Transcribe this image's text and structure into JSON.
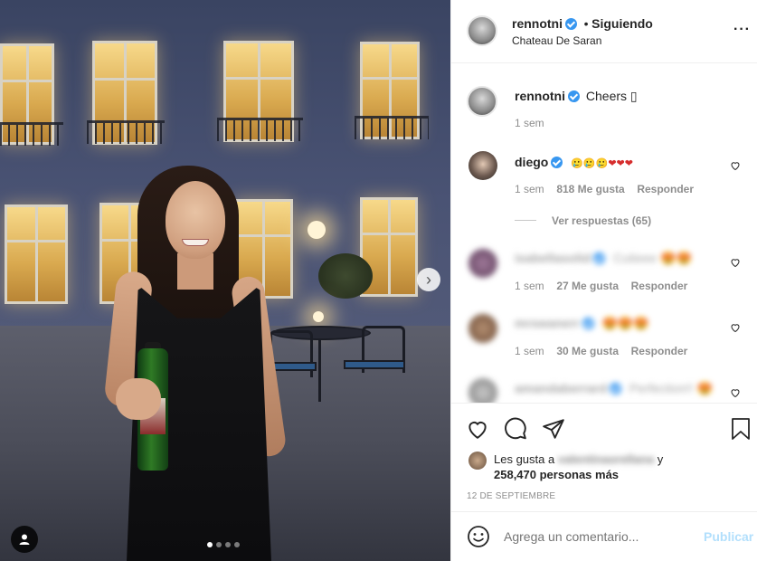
{
  "post": {
    "carousel_dots": 4,
    "active_dot": 0
  },
  "header": {
    "username": "rennotni",
    "separator": "•",
    "follow_status": "Siguiendo",
    "location": "Chateau De Saran",
    "more_label": "···"
  },
  "caption": {
    "username": "rennotni",
    "text": "Cheers ▯",
    "time": "1 sem"
  },
  "comments": [
    {
      "username": "diego",
      "text": "🥲🥲🥲❤❤❤",
      "time": "1 sem",
      "likes": "818 Me gusta",
      "reply_label": "Responder",
      "view_replies": "Ver respuestas (65)",
      "blurred": false
    },
    {
      "username": "isabellasolid",
      "text": "Cutieee 😍😍",
      "time": "1 sem",
      "likes": "27 Me gusta",
      "reply_label": "Responder",
      "blurred": true
    },
    {
      "username": "mrswanerr",
      "text": "😍😍😍",
      "time": "1 sem",
      "likes": "30 Me gusta",
      "reply_label": "Responder",
      "blurred": true
    },
    {
      "username": "amandaberrard",
      "text": "Perfection!! 😍",
      "time": "",
      "likes": "",
      "reply_label": "",
      "blurred": true
    }
  ],
  "likes": {
    "prefix": "Les gusta a",
    "blurred_user": "valentinaorellana",
    "suffix": "y",
    "count_text": "258,470 personas más"
  },
  "date": "12 DE SEPTIEMBRE",
  "comment_input": {
    "placeholder": "Agrega un comentario...",
    "publish_label": "Publicar"
  },
  "colors": {
    "verified": "#3897f0",
    "publish_disabled": "#b2dffc",
    "text_primary": "#262626",
    "text_secondary": "#8e8e8e"
  }
}
